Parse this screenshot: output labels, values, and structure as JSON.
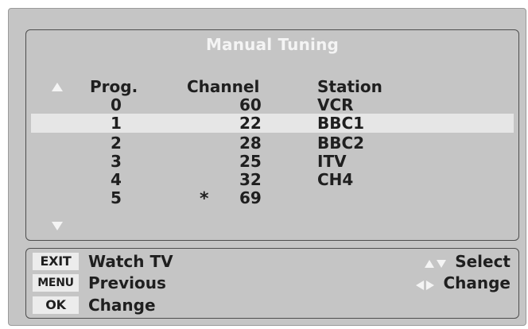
{
  "menu": {
    "title": "Manual Tuning",
    "headers": {
      "prog": "Prog.",
      "channel": "Channel",
      "station": "Station"
    },
    "selected_row": 1,
    "rows": [
      {
        "prog": "0",
        "marker": "",
        "channel": "60",
        "station": "VCR"
      },
      {
        "prog": "1",
        "marker": "",
        "channel": "22",
        "station": "BBC1"
      },
      {
        "prog": "2",
        "marker": "",
        "channel": "28",
        "station": "BBC2"
      },
      {
        "prog": "3",
        "marker": "",
        "channel": "25",
        "station": "ITV"
      },
      {
        "prog": "4",
        "marker": "",
        "channel": "32",
        "station": "CH4"
      },
      {
        "prog": "5",
        "marker": "*",
        "channel": "69",
        "station": ""
      }
    ],
    "scroll_up_icon": "triangle-up-icon",
    "scroll_down_icon": "triangle-down-icon"
  },
  "help": {
    "exit_key": "EXIT",
    "exit_label": "Watch TV",
    "menu_key": "MENU",
    "menu_label": "Previous",
    "ok_key": "OK",
    "ok_label": "Change",
    "select_label": "Select",
    "change_label": "Change",
    "select_icons": "up-down-arrows-icon",
    "change_icons": "left-right-arrows-icon"
  },
  "colors": {
    "background": "#c5c5c5",
    "title_text": "#f4f4f4",
    "text": "#1f1f1f",
    "highlight": "#e6e6e6",
    "key_background": "#ececec",
    "border": "#4e4e4e"
  }
}
